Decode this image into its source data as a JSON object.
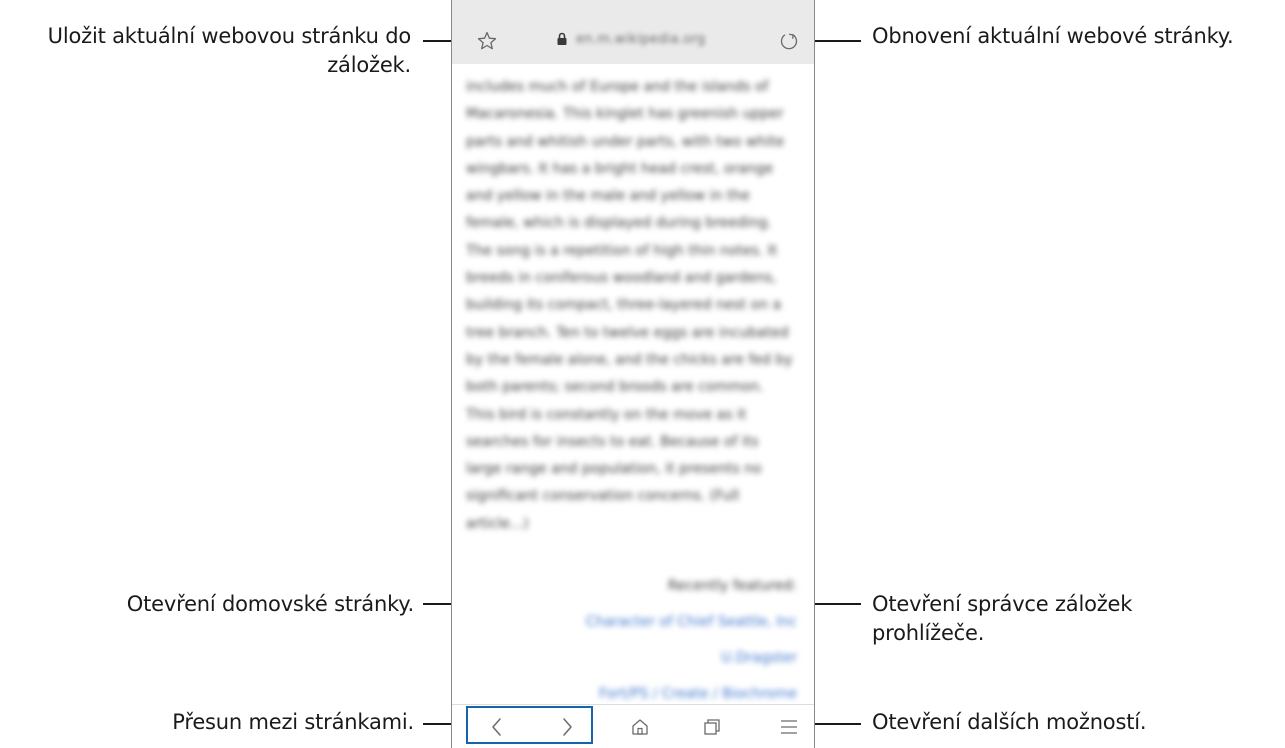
{
  "browser": {
    "url": "en.m.wikipedia.org",
    "article_text": "includes much of Europe and the islands of Macaronesia. This kinglet has greenish upper parts and whitish under parts, with two white wingbars. It has a bright head crest, orange and yellow in the male and yellow in the female, which is displayed during breeding. The song is a repetition of high thin notes. It breeds in coniferous woodland and gardens, building its compact, three-layered nest on a tree branch. Ten to twelve eggs are incubated by the female alone, and the chicks are fed by both parents; second broods are common. This bird is constantly on the move as it searches for insects to eat. Because of its large range and population, it presents no significant conservation concerns. (Full article...)",
    "recent_heading": "Recently featured:",
    "recent_links": [
      "Character of Chief Seattle, Inc",
      "U.Dragster",
      "Fort/PS / Create / Biochrome"
    ],
    "toolbar_icons": [
      "back-icon",
      "forward-icon",
      "home-icon",
      "tabs-icon",
      "menu-icon"
    ]
  },
  "callouts": {
    "bookmark": "Uložit aktuální webovou stránku do záložek.",
    "refresh": "Obnovení aktuální webové stránky.",
    "home": "Otevření domovské stránky.",
    "tabs": "Otevření správce záložek prohlížeče.",
    "navigate": "Přesun mezi stránkami.",
    "more": "Otevření dalších možností."
  },
  "colors": {
    "highlight_box": "#1763ad",
    "link": "#3d76cf",
    "url_bar": "#eaeaea"
  }
}
